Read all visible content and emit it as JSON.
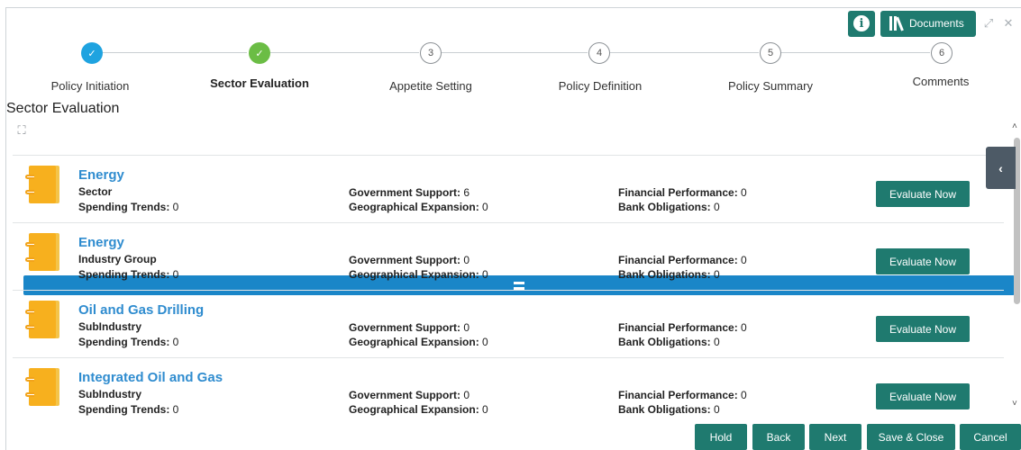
{
  "toolbar": {
    "documents_label": "Documents"
  },
  "steps": [
    {
      "number": "✓",
      "label": "Policy Initiation",
      "state": "done-blue"
    },
    {
      "number": "✓",
      "label": "Sector Evaluation",
      "state": "done-green",
      "active": true
    },
    {
      "number": "3",
      "label": "Appetite Setting",
      "state": "pending"
    },
    {
      "number": "4",
      "label": "Policy Definition",
      "state": "pending"
    },
    {
      "number": "5",
      "label": "Policy Summary",
      "state": "pending"
    },
    {
      "number": "6",
      "label": "Comments",
      "state": "pending"
    }
  ],
  "section_title": "Sector Evaluation",
  "labels": {
    "spending": "Spending Trends:",
    "gov": "Government Support:",
    "geo": "Geographical Expansion:",
    "fin": "Financial Performance:",
    "bank": "Bank Obligations:"
  },
  "rows": [
    {
      "title": "Energy",
      "type": "Sector",
      "spending": " 0",
      "gov": " 6",
      "geo": " 0",
      "fin": " 0",
      "bank": " 0",
      "button": "Evaluate Now"
    },
    {
      "title": "Energy",
      "type": "Industry Group",
      "spending": " 0",
      "gov": " 0",
      "geo": " 0",
      "fin": " 0",
      "bank": " 0",
      "button": "Evaluate Now"
    },
    {
      "title": "Oil and Gas Drilling",
      "type": "SubIndustry",
      "spending": " 0",
      "gov": " 0",
      "geo": " 0",
      "fin": " 0",
      "bank": " 0",
      "button": "Evaluate Now"
    },
    {
      "title": "Integrated Oil and Gas",
      "type": "SubIndustry",
      "spending": " 0",
      "gov": " 0",
      "geo": " 0",
      "fin": " 0",
      "bank": " 0",
      "button": "Evaluate Now"
    }
  ],
  "footer": {
    "hold": "Hold",
    "back": "Back",
    "next": "Next",
    "save_close": "Save & Close",
    "cancel": "Cancel"
  }
}
